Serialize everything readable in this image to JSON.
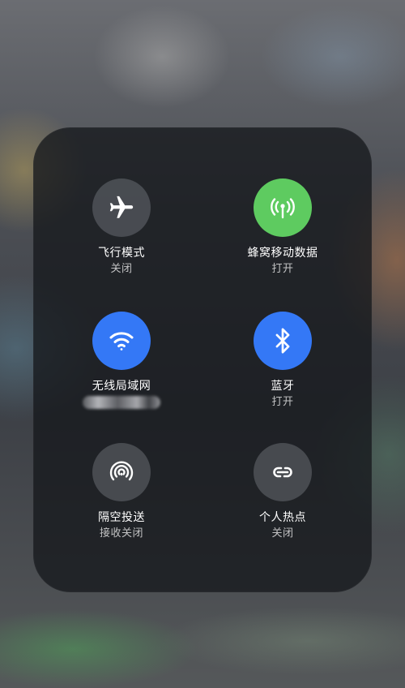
{
  "control_center": {
    "toggles": [
      {
        "label": "飞行模式",
        "status": "关闭",
        "icon": "airplane-icon",
        "state": "off"
      },
      {
        "label": "蜂窝移动数据",
        "status": "打开",
        "icon": "cellular-antenna-icon",
        "state": "on",
        "color": "#5ecb60"
      },
      {
        "label": "无线局域网",
        "status": "",
        "icon": "wifi-icon",
        "state": "on",
        "color": "#3478f6"
      },
      {
        "label": "蓝牙",
        "status": "打开",
        "icon": "bluetooth-icon",
        "state": "on",
        "color": "#3478f6"
      },
      {
        "label": "隔空投送",
        "status": "接收关闭",
        "icon": "airdrop-icon",
        "state": "off"
      },
      {
        "label": "个人热点",
        "status": "关闭",
        "icon": "hotspot-link-icon",
        "state": "off"
      }
    ]
  }
}
